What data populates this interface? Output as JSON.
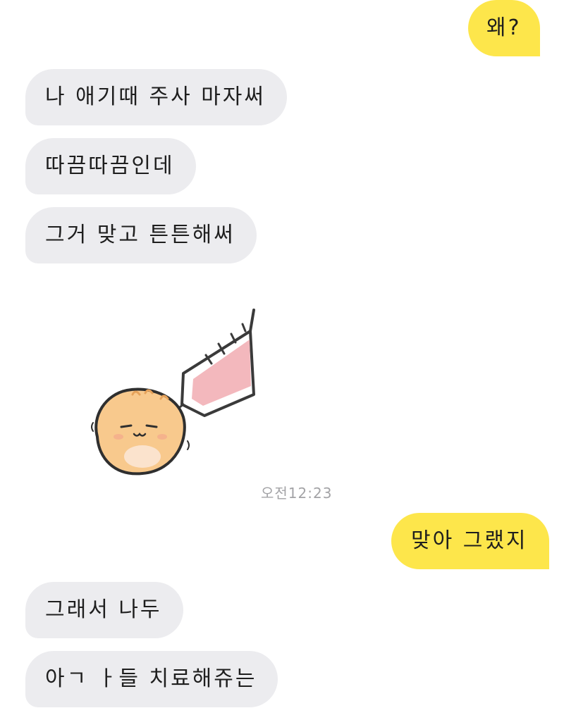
{
  "messages": [
    {
      "sender": "me",
      "text": "왜?"
    },
    {
      "sender": "them",
      "text": "나 애기때 주사 마자써"
    },
    {
      "sender": "them",
      "text": "따끔따끔인데"
    },
    {
      "sender": "them",
      "text": "그거 맞고 튼튼해써"
    },
    {
      "sender": "them",
      "sticker": "hamster-injection-sticker"
    },
    {
      "sender": "me",
      "text": "맞아 그랬지"
    },
    {
      "sender": "them",
      "text": "그래서 나두"
    },
    {
      "sender": "them",
      "text": "아ㄱ ㅏ들 치료해쥬는"
    }
  ],
  "timestamp": "오전12:23",
  "colors": {
    "my_bubble": "#fde64b",
    "their_bubble": "#ececef",
    "timestamp": "#a3a3a6"
  }
}
